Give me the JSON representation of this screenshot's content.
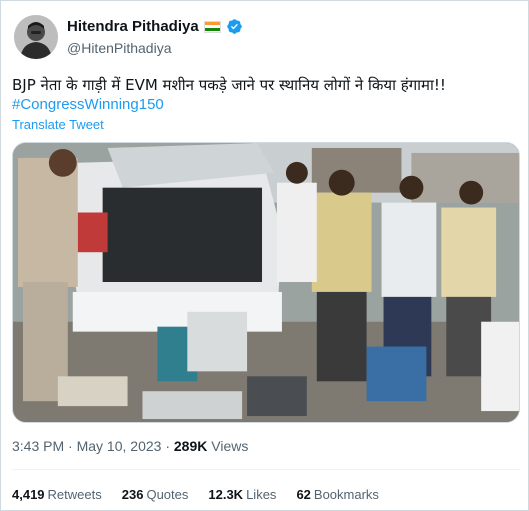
{
  "author": {
    "display_name": "Hitendra Pithadiya",
    "handle": "@HitenPithadiya",
    "flag": "india-flag-icon",
    "verified": "verified-badge-icon"
  },
  "tweet": {
    "text": "BJP नेता के गाड़ी में EVM मशीन पकड़े जाने पर स्थानिय लोगों ने किया हंगामा!!",
    "hashtag": "#CongressWinning150",
    "translate_label": "Translate Tweet"
  },
  "meta": {
    "time": "3:43 PM",
    "separator": "·",
    "date": "May 10, 2023",
    "views_count": "289K",
    "views_label": "Views"
  },
  "stats": {
    "retweets_count": "4,419",
    "retweets_label": "Retweets",
    "quotes_count": "236",
    "quotes_label": "Quotes",
    "likes_count": "12.3K",
    "likes_label": "Likes",
    "bookmarks_count": "62",
    "bookmarks_label": "Bookmarks"
  },
  "colors": {
    "link": "#1d9bf0",
    "secondary_text": "#536471",
    "primary_text": "#0f1419",
    "border": "#cfd9de"
  }
}
